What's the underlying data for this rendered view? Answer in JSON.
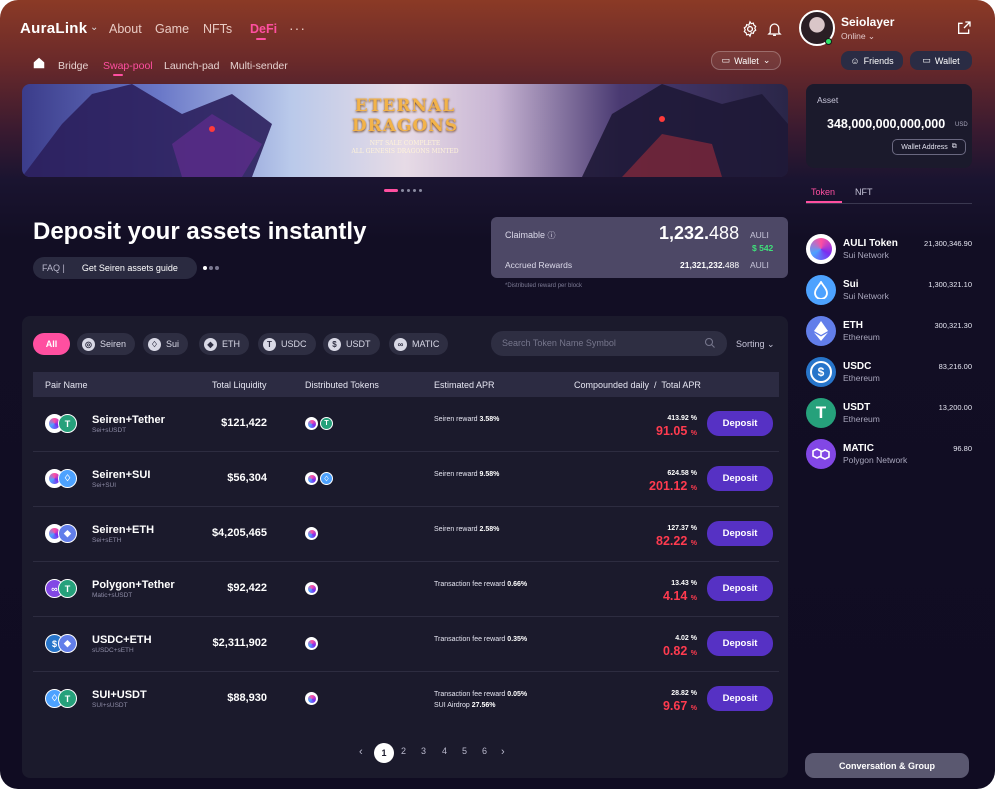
{
  "nav": {
    "logo": "AuraLink",
    "links": [
      "About",
      "Game",
      "NFTs",
      "DeFi"
    ],
    "more": "···",
    "sub_links": [
      "Bridge",
      "Swap-pool",
      "Launch-pad",
      "Multi-sender"
    ],
    "wallet_dropdown": "Wallet"
  },
  "user": {
    "name": "Seiolayer",
    "status": "Online ⌄",
    "friends_label": "Friends",
    "wallet_label": "Wallet"
  },
  "banner": {
    "title_line1": "ETERNAL",
    "title_line2": "DRAGONS",
    "sub_line1": "NFT SALE COMPLETE",
    "sub_line2": "ALL GENESIS DRAGONS MINTED"
  },
  "asset": {
    "label": "Asset",
    "amount": "348,000,000,000,000",
    "unit": "USD",
    "wallet_address_label": "Wallet Address"
  },
  "hero": {
    "title": "Deposit your assets instantly",
    "faq_label": "FAQ |",
    "faq_link": "Get Seiren assets guide"
  },
  "claim": {
    "claimable_label": "Claimable",
    "claimable_int": "1,232.",
    "claimable_dec": "488",
    "claimable_unit": "AULI",
    "usd_value": "$ 542",
    "accrued_label": "Accrued Rewards",
    "accrued_int": "21,321,232.",
    "accrued_dec": "488",
    "accrued_unit": "AULI",
    "note": "*Distributed reward per block"
  },
  "filters": {
    "chips": [
      {
        "label": "All",
        "icon": ""
      },
      {
        "label": "Seiren",
        "icon": "seiren-icon"
      },
      {
        "label": "Sui",
        "icon": "sui-icon"
      },
      {
        "label": "ETH",
        "icon": "eth-icon"
      },
      {
        "label": "USDC",
        "icon": "usdt-icon"
      },
      {
        "label": "USDT",
        "icon": "usdc-icon"
      },
      {
        "label": "MATIC",
        "icon": "matic-icon"
      }
    ],
    "search_placeholder": "Search Token Name Symbol",
    "sorting_label": "Sorting"
  },
  "table": {
    "headers": [
      "Pair Name",
      "Total Liquidity",
      "Distributed Tokens",
      "Estimated APR",
      "Compounded daily  /  Total APR"
    ],
    "deposit_label": "Deposit",
    "rows": [
      {
        "name": "Seiren+Tether",
        "sub": "Sei+sUSDT",
        "liquidity": "$121,422",
        "apr_label": "Seiren reward",
        "apr_value": "3.58%",
        "apr_label2": "",
        "apr_value2": "",
        "compounded": "413.92",
        "total": "91.05"
      },
      {
        "name": "Seiren+SUI",
        "sub": "Sei+SUI",
        "liquidity": "$56,304",
        "apr_label": "Seiren reward",
        "apr_value": "9.58%",
        "apr_label2": "",
        "apr_value2": "",
        "compounded": "624.58",
        "total": "201.12"
      },
      {
        "name": "Seiren+ETH",
        "sub": "Sei+sETH",
        "liquidity": "$4,205,465",
        "apr_label": "Seiren reward",
        "apr_value": "2.58%",
        "apr_label2": "",
        "apr_value2": "",
        "compounded": "127.37",
        "total": "82.22"
      },
      {
        "name": "Polygon+Tether",
        "sub": "Matic+sUSDT",
        "liquidity": "$92,422",
        "apr_label": "Transaction fee reward",
        "apr_value": "0.66%",
        "apr_label2": "",
        "apr_value2": "",
        "compounded": "13.43",
        "total": "4.14"
      },
      {
        "name": "USDC+ETH",
        "sub": "sUSDC+sETH",
        "liquidity": "$2,311,902",
        "apr_label": "Transaction fee reward",
        "apr_value": "0.35%",
        "apr_label2": "",
        "apr_value2": "",
        "compounded": "4.02",
        "total": "0.82"
      },
      {
        "name": "SUI+USDT",
        "sub": "SUI+sUSDT",
        "liquidity": "$88,930",
        "apr_label": "Transaction fee reward",
        "apr_value": "0.05%",
        "apr_label2": "SUI Airdrop",
        "apr_value2": "27.56%",
        "compounded": "28.82",
        "total": "9.67"
      }
    ],
    "percent": "%"
  },
  "pagination": {
    "pages": [
      "1",
      "2",
      "3",
      "4",
      "5",
      "6"
    ],
    "current": "1"
  },
  "tabs": [
    "Token",
    "NFT"
  ],
  "tokens": [
    {
      "name": "AULI Token",
      "network": "Sui Network",
      "balance": "21,300,346.90",
      "color": "#7b2cf0"
    },
    {
      "name": "Sui",
      "network": "Sui Network",
      "balance": "1,300,321.10",
      "color": "#4da2ff"
    },
    {
      "name": "ETH",
      "network": "Ethereum",
      "balance": "300,321.30",
      "color": "#627eea"
    },
    {
      "name": "USDC",
      "network": "Ethereum",
      "balance": "83,216.00",
      "color": "#2775ca"
    },
    {
      "name": "USDT",
      "network": "Ethereum",
      "balance": "13,200.00",
      "color": "#26a17b"
    },
    {
      "name": "MATIC",
      "network": "Polygon Network",
      "balance": "96.80",
      "color": "#8247e5"
    }
  ],
  "conversation_label": "Conversation & Group",
  "colors": {
    "accent": "#ff4fa0",
    "deposit": "#5631c4",
    "negative": "#ff3b4f"
  }
}
